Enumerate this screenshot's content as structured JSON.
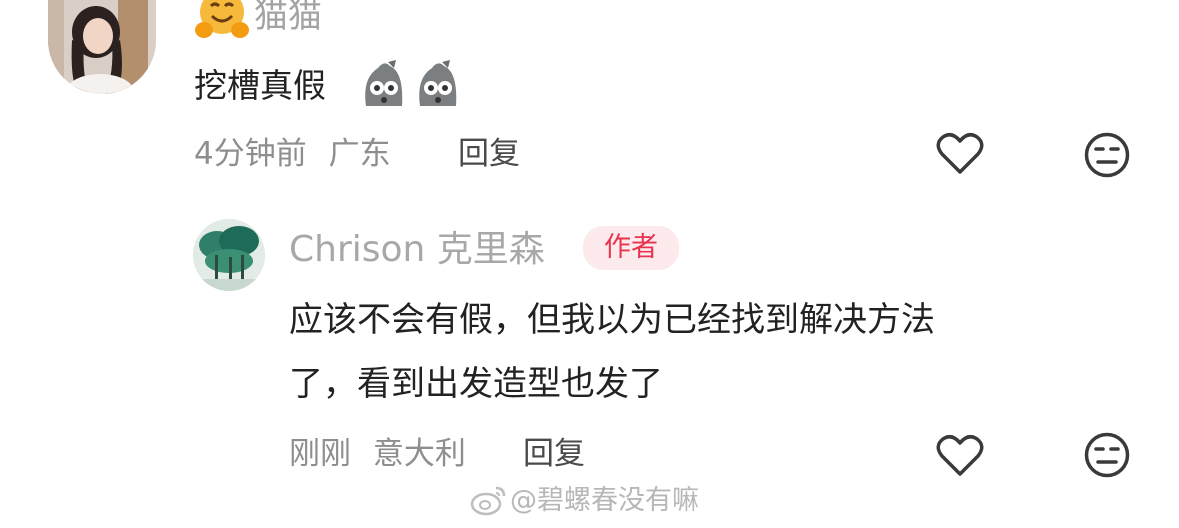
{
  "comment": {
    "username": "猫猫",
    "text": "挖槽真假",
    "time": "4分钟前",
    "location": "广东",
    "reply_label": "回复",
    "emoji_count": 2
  },
  "reply_comment": {
    "username": "Chrison 克里森",
    "author_badge": "作者",
    "text_line1": "应该不会有假，但我以为已经找到解决方法",
    "text_line2": "了，看到出发造型也发了",
    "time": "刚刚",
    "location": "意大利",
    "reply_label": "回复"
  },
  "watermark": "@碧螺春没有嘛",
  "icons": [
    "hugging-face-emoji-icon",
    "ghost-emoji-icon",
    "heart-icon",
    "dislike-face-icon",
    "weibo-logo-icon"
  ]
}
